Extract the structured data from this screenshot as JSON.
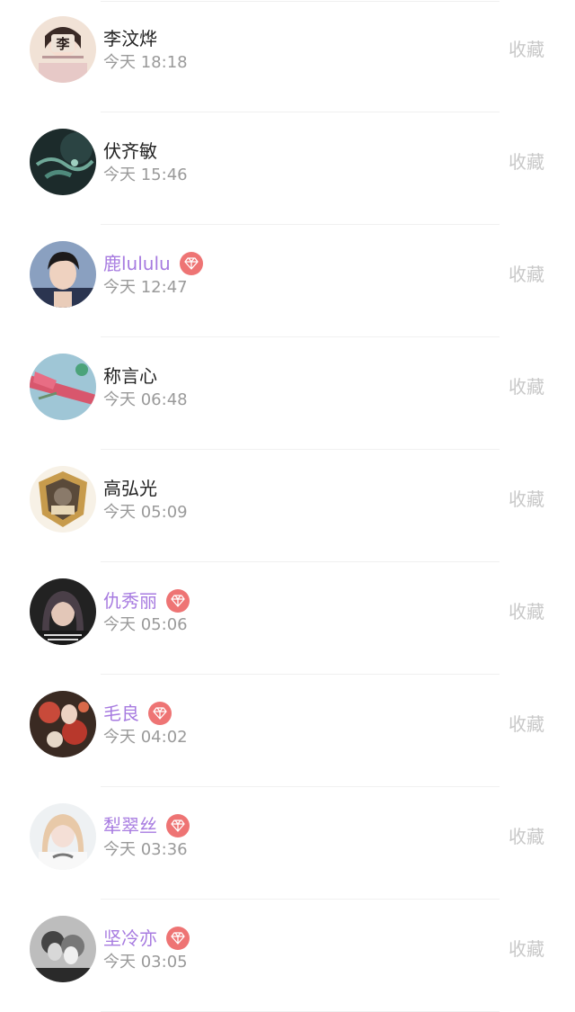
{
  "items": [
    {
      "name": "李汶烨",
      "time": "今天 18:18",
      "action": "收藏",
      "vip": false,
      "avatar": "avatar-illustration-li"
    },
    {
      "name": "伏齐敏",
      "time": "今天 15:46",
      "action": "收藏",
      "vip": false,
      "avatar": "avatar-dark-green"
    },
    {
      "name": "鹿lululu",
      "time": "今天 12:47",
      "action": "收藏",
      "vip": true,
      "avatar": "avatar-boy-portrait"
    },
    {
      "name": "称言心",
      "time": "今天 06:48",
      "action": "收藏",
      "vip": false,
      "avatar": "avatar-pink-blue"
    },
    {
      "name": "高弘光",
      "time": "今天 05:09",
      "action": "收藏",
      "vip": false,
      "avatar": "avatar-game-badge"
    },
    {
      "name": "仇秀丽",
      "time": "今天 05:06",
      "action": "收藏",
      "vip": true,
      "avatar": "avatar-girl-dark"
    },
    {
      "name": "毛良",
      "time": "今天 04:02",
      "action": "收藏",
      "vip": true,
      "avatar": "avatar-red-flowers"
    },
    {
      "name": "犁翠丝",
      "time": "今天 03:36",
      "action": "收藏",
      "vip": true,
      "avatar": "avatar-girl-light"
    },
    {
      "name": "坚冷亦",
      "time": "今天 03:05",
      "action": "收藏",
      "vip": true,
      "avatar": "avatar-bw-couple"
    }
  ],
  "colors": {
    "vip_name": "#a77be0",
    "vip_badge": "#ee7474",
    "name": "#222222",
    "time": "#9a9a9a",
    "action": "#c8c8c8"
  },
  "icons": {
    "vip_badge": "diamond-icon"
  }
}
